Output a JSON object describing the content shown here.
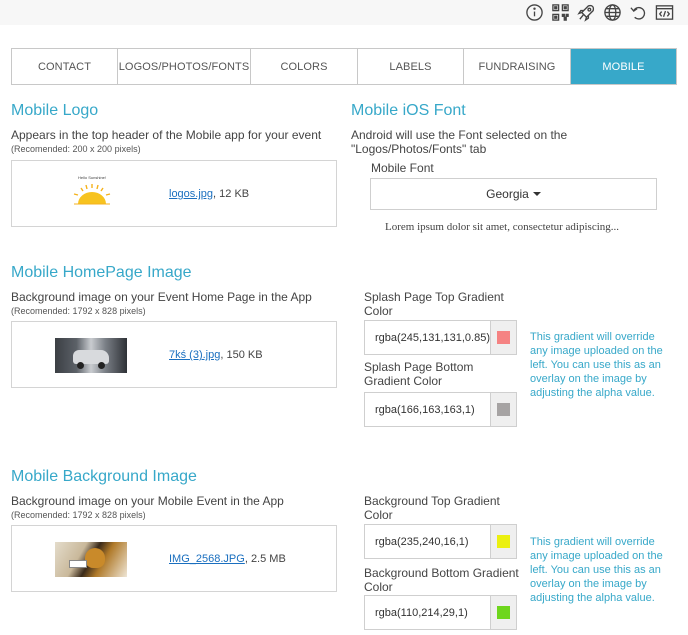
{
  "toolbar": {
    "icons": [
      "info-icon",
      "qr-code-icon",
      "rocket-icon",
      "globe-icon",
      "undo-icon",
      "code-icon"
    ]
  },
  "tabs": [
    {
      "label": "CONTACT",
      "active": false
    },
    {
      "label": "LOGOS/PHOTOS/FONTS",
      "active": false
    },
    {
      "label": "COLORS",
      "active": false
    },
    {
      "label": "LABELS",
      "active": false
    },
    {
      "label": "FUNDRAISING",
      "active": false
    },
    {
      "label": "MOBILE",
      "active": true
    }
  ],
  "mobile_logo": {
    "title": "Mobile Logo",
    "description": "Appears in the top header of the Mobile app for your event",
    "recommended": "(Recomended: 200 x 200 pixels)",
    "thumb_text": "Hello Sunshine!",
    "file_name": "logos.jpg",
    "file_size": ", 12 KB"
  },
  "ios_font": {
    "title": "Mobile iOS Font",
    "description": "Android will use the Font selected on the \"Logos/Photos/Fonts\" tab",
    "field_label": "Mobile Font",
    "selected": "Georgia",
    "preview": "Lorem ipsum dolor sit amet, consectetur adipiscing..."
  },
  "homepage_image": {
    "title": "Mobile HomePage Image",
    "description": "Background image on your Event Home Page in the App",
    "recommended": "(Recomended: 1792 x 828 pixels)",
    "file_name": "7kś (3).jpg",
    "file_size": ", 150 KB",
    "top_gradient_label": "Splash Page Top Gradient Color",
    "top_gradient_value": "rgba(245,131,131,0.85)",
    "top_gradient_color": "#f58383",
    "bottom_gradient_label": "Splash Page Bottom Gradient Color",
    "bottom_gradient_value": "rgba(166,163,163,1)",
    "bottom_gradient_color": "#a6a3a3",
    "hint": "This gradient will override any image uploaded on the left. You can use this as an overlay on the image by adjusting the alpha value."
  },
  "background_image": {
    "title": "Mobile Background Image",
    "description": "Background image on your Mobile Event in the App",
    "recommended": "(Recomended: 1792 x 828 pixels)",
    "file_name": "IMG_2568.JPG",
    "file_size": ", 2.5 MB",
    "top_gradient_label": "Background Top Gradient Color",
    "top_gradient_value": "rgba(235,240,16,1)",
    "top_gradient_color": "#ebf010",
    "bottom_gradient_label": "Background Bottom Gradient Color",
    "bottom_gradient_value": "rgba(110,214,29,1)",
    "bottom_gradient_color": "#6ed61d",
    "hint": "This gradient will override any image uploaded on the left. You can use this as an overlay on the image by adjusting the alpha value."
  },
  "colors": {
    "accent": "#37a8c9",
    "link": "#1a6fbf"
  }
}
